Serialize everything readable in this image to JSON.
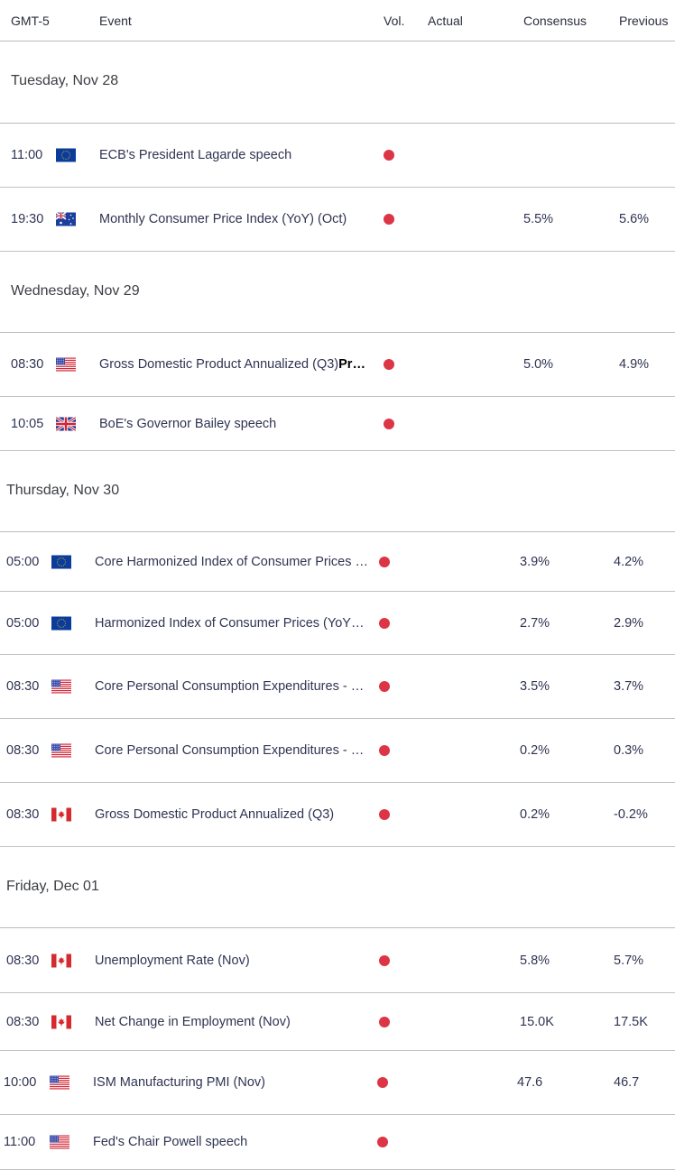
{
  "header": {
    "timezone": "GMT-5",
    "event": "Event",
    "vol": "Vol.",
    "actual": "Actual",
    "consensus": "Consensus",
    "previous": "Previous"
  },
  "colors": {
    "volatility_high": "#dc3545"
  },
  "days": [
    {
      "label": "Tuesday, Nov 28",
      "events": [
        {
          "time": "11:00",
          "flag": "eu-flag-icon",
          "event": "ECB's President Lagarde speech",
          "event_bold": "",
          "vol": "high",
          "actual": "",
          "consensus": "",
          "previous": ""
        },
        {
          "time": "19:30",
          "flag": "au-flag-icon",
          "event": "Monthly Consumer Price Index (YoY) (Oct)",
          "event_bold": "",
          "vol": "high",
          "actual": "",
          "consensus": "5.5%",
          "previous": "5.6%"
        }
      ]
    },
    {
      "label": "Wednesday, Nov 29",
      "events": [
        {
          "time": "08:30",
          "flag": "us-flag-icon",
          "event": "Gross Domestic Product Annualized (Q3)",
          "event_bold": "Pr…",
          "vol": "high",
          "actual": "",
          "consensus": "5.0%",
          "previous": "4.9%"
        },
        {
          "time": "10:05",
          "flag": "uk-flag-icon",
          "event": "BoE's Governor Bailey speech",
          "event_bold": "",
          "vol": "high",
          "actual": "",
          "consensus": "",
          "previous": ""
        }
      ]
    },
    {
      "label": "Thursday, Nov 30",
      "events": [
        {
          "time": "05:00",
          "flag": "eu-flag-icon",
          "event": "Core Harmonized Index of Consumer Prices …",
          "event_bold": "",
          "vol": "high",
          "actual": "",
          "consensus": "3.9%",
          "previous": "4.2%"
        },
        {
          "time": "05:00",
          "flag": "eu-flag-icon",
          "event": "Harmonized Index of Consumer Prices (YoY…",
          "event_bold": "",
          "vol": "high",
          "actual": "",
          "consensus": "2.7%",
          "previous": "2.9%"
        },
        {
          "time": "08:30",
          "flag": "us-flag-icon",
          "event": "Core Personal Consumption Expenditures - …",
          "event_bold": "",
          "vol": "high",
          "actual": "",
          "consensus": "3.5%",
          "previous": "3.7%"
        },
        {
          "time": "08:30",
          "flag": "us-flag-icon",
          "event": "Core Personal Consumption Expenditures - …",
          "event_bold": "",
          "vol": "high",
          "actual": "",
          "consensus": "0.2%",
          "previous": "0.3%"
        },
        {
          "time": "08:30",
          "flag": "ca-flag-icon",
          "event": "Gross Domestic Product Annualized (Q3)",
          "event_bold": "",
          "vol": "high",
          "actual": "",
          "consensus": "0.2%",
          "previous": "-0.2%"
        }
      ]
    },
    {
      "label": "Friday, Dec 01",
      "events": [
        {
          "time": "08:30",
          "flag": "ca-flag-icon",
          "event": "Unemployment Rate (Nov)",
          "event_bold": "",
          "vol": "high",
          "actual": "",
          "consensus": "5.8%",
          "previous": "5.7%"
        },
        {
          "time": "08:30",
          "flag": "ca-flag-icon",
          "event": "Net Change in Employment (Nov)",
          "event_bold": "",
          "vol": "high",
          "actual": "",
          "consensus": "15.0K",
          "previous": "17.5K"
        },
        {
          "time": "10:00",
          "flag": "us-flag-icon",
          "event": "ISM Manufacturing PMI (Nov)",
          "event_bold": "",
          "vol": "high",
          "actual": "",
          "consensus": "47.6",
          "previous": "46.7"
        },
        {
          "time": "11:00",
          "flag": "us-flag-icon",
          "event": "Fed's Chair Powell speech",
          "event_bold": "",
          "vol": "high",
          "actual": "",
          "consensus": "",
          "previous": ""
        }
      ]
    }
  ]
}
